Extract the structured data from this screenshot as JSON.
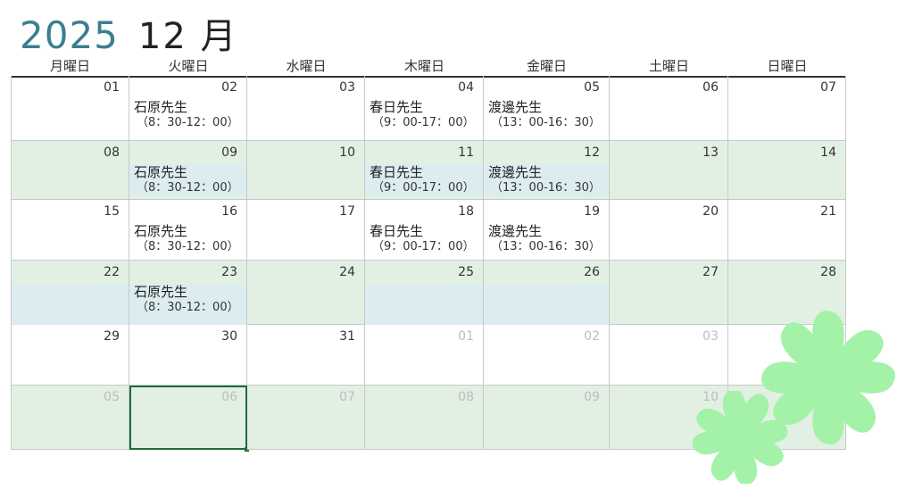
{
  "header": {
    "year": "2025",
    "month": "12 月"
  },
  "weekdays": [
    "月曜日",
    "火曜日",
    "水曜日",
    "木曜日",
    "金曜日",
    "土曜日",
    "日曜日"
  ],
  "weeks": [
    {
      "days": [
        {
          "num": "01"
        },
        {
          "num": "02",
          "event": {
            "name": "石原先生",
            "time": "（8：30-12：00）"
          }
        },
        {
          "num": "03"
        },
        {
          "num": "04",
          "event": {
            "name": "春日先生",
            "time": "（9：00-17：00）"
          }
        },
        {
          "num": "05",
          "event": {
            "name": "渡邊先生",
            "time": "（13：00-16：30）"
          }
        },
        {
          "num": "06"
        },
        {
          "num": "07"
        }
      ]
    },
    {
      "days": [
        {
          "num": "08"
        },
        {
          "num": "09",
          "event": {
            "name": "石原先生",
            "time": "（8：30-12：00）"
          }
        },
        {
          "num": "10"
        },
        {
          "num": "11",
          "event": {
            "name": "春日先生",
            "time": "（9：00-17：00）"
          }
        },
        {
          "num": "12",
          "event": {
            "name": "渡邊先生",
            "time": "（13：00-16：30）"
          }
        },
        {
          "num": "13"
        },
        {
          "num": "14"
        }
      ]
    },
    {
      "days": [
        {
          "num": "15"
        },
        {
          "num": "16",
          "event": {
            "name": "石原先生",
            "time": "（8：30-12：00）"
          }
        },
        {
          "num": "17"
        },
        {
          "num": "18",
          "event": {
            "name": "春日先生",
            "time": "（9：00-17：00）"
          }
        },
        {
          "num": "19",
          "event": {
            "name": "渡邊先生",
            "time": "（13：00-16：30）"
          }
        },
        {
          "num": "20"
        },
        {
          "num": "21"
        }
      ]
    },
    {
      "days": [
        {
          "num": "22"
        },
        {
          "num": "23",
          "event": {
            "name": "石原先生",
            "time": "（8：30-12：00）"
          }
        },
        {
          "num": "24"
        },
        {
          "num": "25"
        },
        {
          "num": "26"
        },
        {
          "num": "27"
        },
        {
          "num": "28"
        }
      ]
    },
    {
      "days": [
        {
          "num": "29"
        },
        {
          "num": "30"
        },
        {
          "num": "31"
        },
        {
          "num": "01"
        },
        {
          "num": "02"
        },
        {
          "num": "03"
        },
        {
          "num": ""
        }
      ]
    },
    {
      "days": [
        {
          "num": "05"
        },
        {
          "num": "06"
        },
        {
          "num": "07"
        },
        {
          "num": "08"
        },
        {
          "num": "09"
        },
        {
          "num": "10"
        },
        {
          "num": ""
        }
      ]
    }
  ],
  "colors": {
    "year": "#3b7f8f",
    "shade": "#e1f0e3",
    "highlight": "#dcedf0",
    "clover": "#a3f2a8",
    "selection": "#1f6b3a"
  },
  "icons": {
    "decoration": "four-leaf-clover-icon"
  }
}
